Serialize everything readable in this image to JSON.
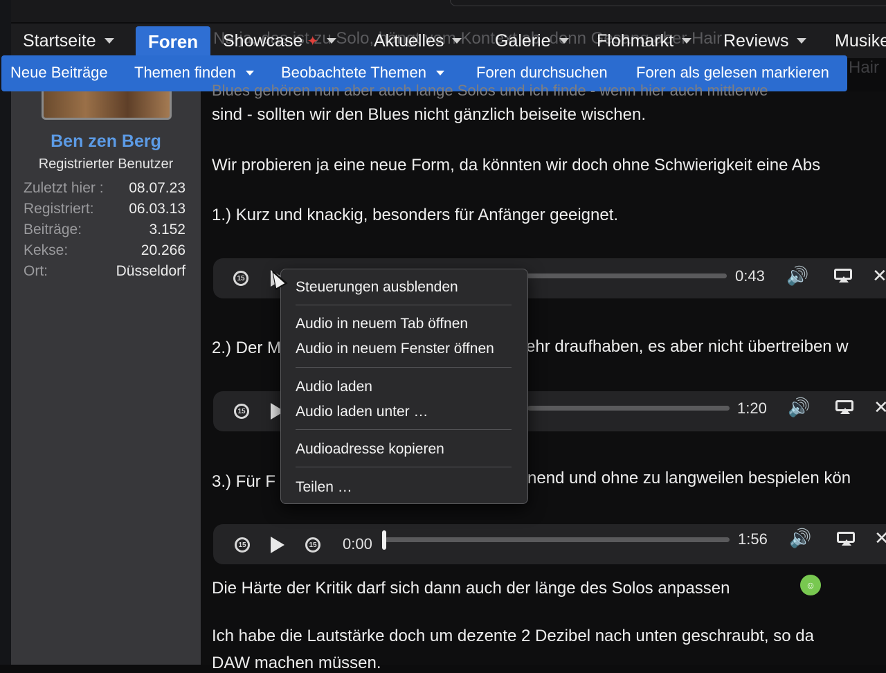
{
  "nav": {
    "items": [
      {
        "label": "Startseite",
        "dropdown": true
      },
      {
        "label": "Foren",
        "active": true
      },
      {
        "label": "Showcase",
        "dropdown": true
      },
      {
        "label": "Aktuelles",
        "dropdown": true
      },
      {
        "label": "Galerie",
        "dropdown": true
      },
      {
        "label": "Flohmarkt",
        "dropdown": true
      },
      {
        "label": "Reviews",
        "dropdown": true
      },
      {
        "label": "Musike"
      }
    ],
    "ghost_text": "Na ja, das ist zu Solo, hängt vom Kontext ab, denn Gesang aber Hair"
  },
  "subnav": {
    "items": [
      {
        "label": "Neue Beiträge"
      },
      {
        "label": "Themen finden",
        "dropdown": true
      },
      {
        "label": "Beobachtete Themen",
        "dropdown": true
      },
      {
        "label": "Foren durchsuchen"
      },
      {
        "label": "Foren als gelesen markieren"
      }
    ],
    "hair": "Hair"
  },
  "user": {
    "name": "Ben zen Berg",
    "title": "Registrierter Benutzer",
    "stats": [
      {
        "label": "Zuletzt hier :",
        "value": "08.07.23"
      },
      {
        "label": "Registriert:",
        "value": "06.03.13"
      },
      {
        "label": "Beiträge:",
        "value": "3.152"
      },
      {
        "label": "Kekse:",
        "value": "20.266"
      },
      {
        "label": "Ort:",
        "value": "Düsseldorf"
      }
    ]
  },
  "post": {
    "cut_line": "Blues gehören nun aber auch lange Solos und ich finde - wenn hier auch mittlerwe",
    "line1": "sind - sollten wir den Blues nicht gänzlich beiseite wischen.",
    "line2": "Wir probieren ja eine neue Form, da könnten wir doch ohne Schwierigkeit eine Abs",
    "item1": "1.) Kurz und knackig, besonders für Anfänger geeignet.",
    "item2_start": "2.) Der M",
    "item2_end": "ehr draufhaben, es aber nicht übertreiben w",
    "item3_start": "3.) Für F",
    "item3_end": "nend und ohne zu langweilen bespielen kön",
    "line3": "Die Härte der Kritik darf sich dann auch der länge des Solos anpassen",
    "line4": "Ich habe die Lautstärke doch um dezente 2 Dezibel nach unten geschraubt, so da",
    "line5": "DAW machen müssen."
  },
  "players": [
    {
      "duration": "0:43",
      "skip": "15"
    },
    {
      "duration": "1:20",
      "skip": "15"
    },
    {
      "current": "0:00",
      "duration": "1:56",
      "skip": "15"
    }
  ],
  "context_menu": {
    "items": [
      "Steuerungen ausblenden",
      "Audio in neuem Tab öffnen",
      "Audio in neuem Fenster öffnen",
      "Audio laden",
      "Audio laden unter …",
      "Audioadresse kopieren",
      "Teilen …"
    ]
  },
  "icons": {
    "volume": "🔊",
    "close": "✕",
    "emoji": "grinning-face"
  },
  "colors": {
    "accent": "#2b6cd0",
    "username": "#5c9be6"
  }
}
